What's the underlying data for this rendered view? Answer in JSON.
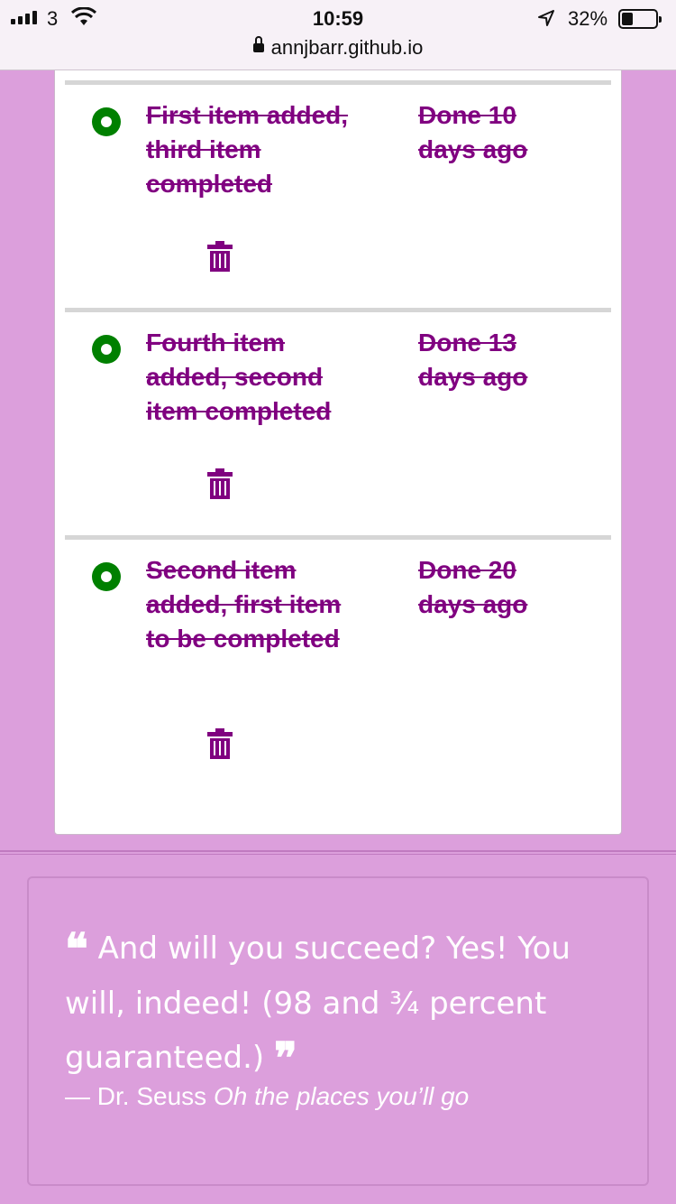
{
  "status_bar": {
    "carrier": "3",
    "time": "10:59",
    "battery_percent": "32%",
    "battery_level": 0.32
  },
  "browser": {
    "url": "annjbarr.github.io"
  },
  "todo_items": [
    {
      "text": "First item added, third item completed",
      "done": "Done 10 days ago",
      "completed": true
    },
    {
      "text": "Fourth item added, second item completed",
      "done": "Done 13 days ago",
      "completed": true
    },
    {
      "text": "Second item added, first item to be completed",
      "done": "Done 20 days ago",
      "completed": true
    }
  ],
  "footer": {
    "quote": "And will you succeed? Yes! You will, indeed! (98 and ¾ percent guaranteed.)",
    "open_mark": "❝",
    "close_mark": "❞",
    "author": "— Dr. Seuss",
    "source": "Oh the places you’ll go"
  },
  "colors": {
    "background": "#dc9fdc",
    "item_text": "#800080",
    "radio": "#008000",
    "quote_text": "#ffffff"
  }
}
